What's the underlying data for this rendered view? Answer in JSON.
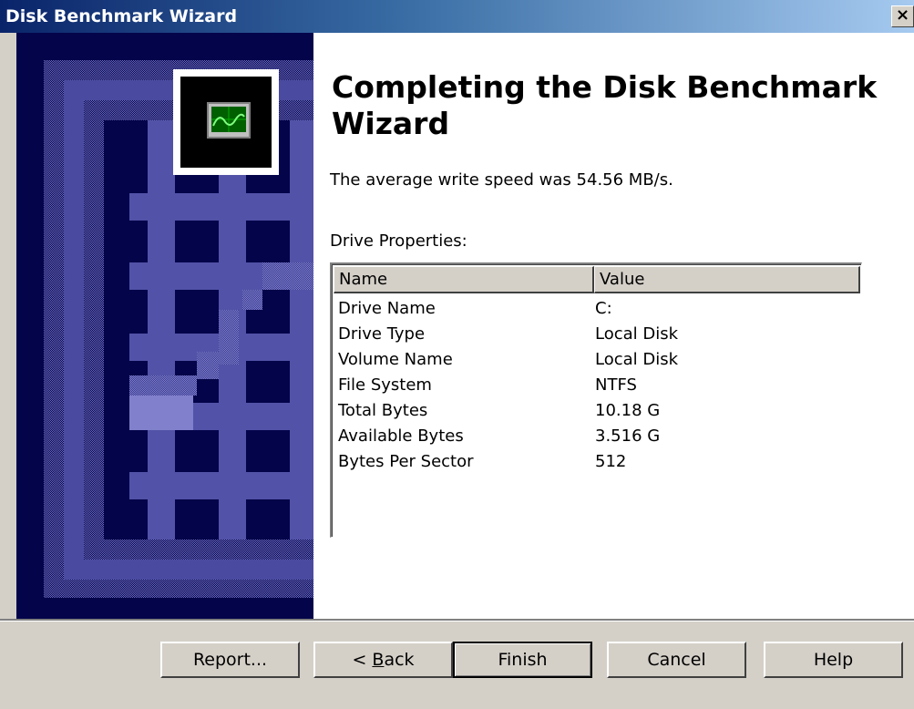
{
  "window": {
    "title": "Disk Benchmark Wizard",
    "close_label": "×"
  },
  "side_icon": "benchmark-monitor-icon",
  "heading": "Completing the Disk Benchmark Wizard",
  "message": "The average write speed was 54.56 MB/s.",
  "properties_label": "Drive Properties:",
  "list": {
    "columns": [
      "Name",
      "Value"
    ],
    "rows": [
      {
        "name": "Drive Name",
        "value": "C:"
      },
      {
        "name": "Drive Type",
        "value": "Local Disk"
      },
      {
        "name": "Volume Name",
        "value": "Local Disk"
      },
      {
        "name": "File System",
        "value": "NTFS"
      },
      {
        "name": "Total Bytes",
        "value": "10.18 G"
      },
      {
        "name": "Available Bytes",
        "value": "3.516 G"
      },
      {
        "name": "Bytes Per Sector",
        "value": "512"
      }
    ]
  },
  "buttons": {
    "report": "Report...",
    "back_prefix": "< ",
    "back_accel": "B",
    "back_rest": "ack",
    "finish": "Finish",
    "cancel": "Cancel",
    "help": "Help"
  },
  "colors": {
    "titlebar_start": "#0a246a",
    "titlebar_end": "#a6caf0",
    "panel_dark": "#04044a",
    "panel_light": "#6c6cb4",
    "face": "#d4d0c8"
  }
}
